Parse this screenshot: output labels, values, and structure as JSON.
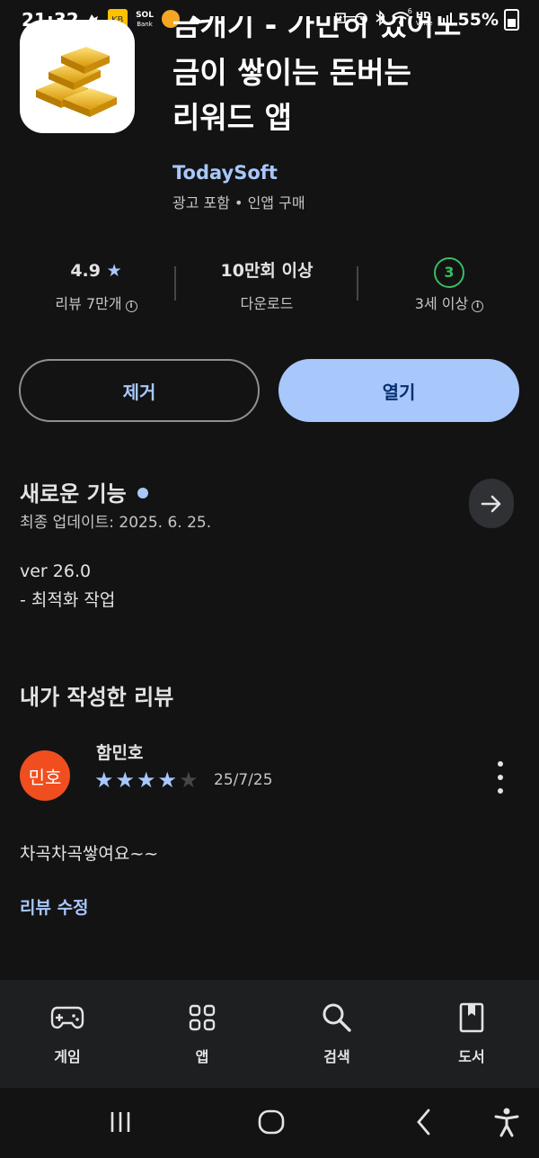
{
  "status_bar": {
    "time": "21:32",
    "battery_percent": "55%",
    "left_icons": [
      "running-app-icon",
      "kb-app-icon",
      "sol-bank-icon",
      "shopping-app-icon",
      "sneaker-app-icon"
    ],
    "right_icons": [
      "recycle-icon",
      "alarm-icon",
      "bluetooth-icon",
      "wifi-icon",
      "hd-voice-icon",
      "signal-icon",
      "battery-icon"
    ],
    "hd_label": "HD",
    "voice_label": "Voice",
    "wifi_num": "6",
    "sol_label": "SOL",
    "bank_label": "Bank"
  },
  "app": {
    "title_line1": "금캐기 - 가만히 있어도",
    "title_line2": "금이 쌓이는 돈버는",
    "title_line3": "리워드 앱",
    "developer": "TodaySoft",
    "subinfo": "광고 포함 • 인앱 구매"
  },
  "stats": {
    "rating": "4.9",
    "rating_star": "★",
    "reviews_label": "리뷰 7만개",
    "downloads": "10만회 이상",
    "downloads_label": "다운로드",
    "age_value": "3",
    "age_label": "3세 이상",
    "info_glyph": "i"
  },
  "buttons": {
    "remove": "제거",
    "open": "열기"
  },
  "whats_new": {
    "title": "새로운 기능",
    "updated": "최종 업데이트: 2025. 6. 25.",
    "version": "ver 26.0",
    "notes": "- 최적화 작업"
  },
  "my_review": {
    "section_title": "내가 작성한 리뷰",
    "avatar_text": "민호",
    "reviewer": "함민호",
    "stars_filled": 4,
    "stars_total": 5,
    "date": "25/7/25",
    "text": "차곡차곡쌓여요~~",
    "edit_link": "리뷰 수정"
  },
  "bottom_nav": {
    "items": [
      {
        "label": "게임",
        "icon": "gamepad-icon"
      },
      {
        "label": "앱",
        "icon": "apps-grid-icon"
      },
      {
        "label": "검색",
        "icon": "search-icon"
      },
      {
        "label": "도서",
        "icon": "book-icon"
      }
    ]
  },
  "colors": {
    "background": "#131314",
    "accent": "#a8c7fa",
    "avatar": "#f04e1e",
    "age_badge": "#37be5f"
  }
}
